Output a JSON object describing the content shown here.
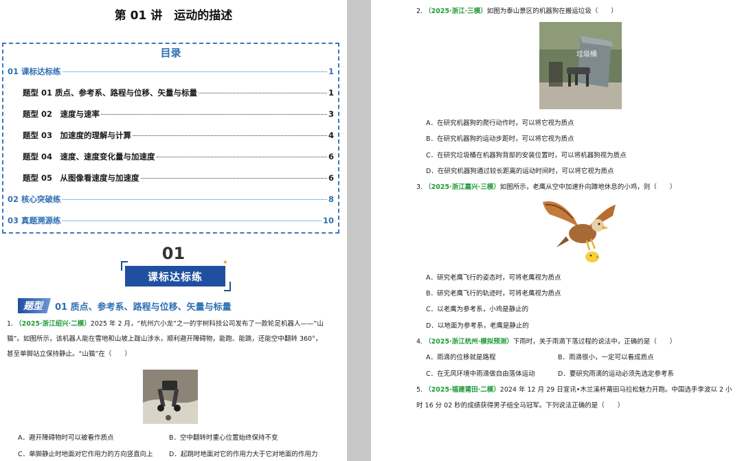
{
  "doc_title": "第 01 讲　运动的描述",
  "toc": {
    "heading": "目录",
    "lines": [
      {
        "label": "01  课标达标练",
        "page": "1",
        "level": 1
      },
      {
        "label": "题型 01  质点、参考系、路程与位移、矢量与标量",
        "page": "1",
        "level": 2
      },
      {
        "label": "题型 02　速度与速率",
        "page": "3",
        "level": 2
      },
      {
        "label": "题型 03　加速度的理解与计算",
        "page": "4",
        "level": 2
      },
      {
        "label": "题型 04　速度、速度变化量与加速度",
        "page": "6",
        "level": 2
      },
      {
        "label": "题型 05　从图像看速度与加速度",
        "page": "6",
        "level": 2
      },
      {
        "label": "02  核心突破练",
        "page": "8",
        "level": 1
      },
      {
        "label": "03  真题溯源练",
        "page": "10",
        "level": 1
      }
    ]
  },
  "section": {
    "number": "01",
    "banner": "课标达标练"
  },
  "topic": {
    "tag": "题型",
    "title": "01  质点、参考系、路程与位移、矢量与标量"
  },
  "questions": {
    "q1": {
      "num": "1.",
      "source": "（2025·浙江绍兴·二模）",
      "line1": "2025 年 2 月，“杭州六小龙”之一的宇树科技公司发布了一款轮足机器人——“山",
      "line2": "猫”。如图所示，该机器人能在雪地和山坡上跋山涉水，顺利避开障碍物，能跑、能跳，还能空中翻转 360°，",
      "line3": "甚至单脚站立保持静止。“山猫”在（　　）",
      "choices": {
        "A": "A．避开障碍物时可以被看作质点",
        "B": "B．空中翻转时重心位置始终保持不变",
        "C": "C．单脚静止时地面对它作用力的方向竖直向上",
        "D": "D．起跳时地面对它的作用力大于它对地面的作用力"
      }
    },
    "q2": {
      "num": "2.",
      "source": "（2025·浙江·三模）",
      "stem": "如图为泰山景区的机器狗在搬运垃圾（　　）",
      "photo_label": "垃圾桶",
      "choices": {
        "A": "A．在研究机器狗的爬行动作时，可以将它视为质点",
        "B": "B．在研究机器狗的运动步距时，可以将它视为质点",
        "C": "C．在研究垃圾桶在机器狗背部的安装位置时，可以将机器狗视为质点",
        "D": "D．在研究机器狗通过较长距离的运动时间时，可以将它视为质点"
      }
    },
    "q3": {
      "num": "3.",
      "source": "（2025·浙江嘉兴·三模）",
      "stem": "如图所示，老鹰从空中加速扑向蹲地休息的小鸡，则（　　）",
      "choices": {
        "A": "A．研究老鹰飞行的姿态时，可将老鹰视为质点",
        "B": "B．研究老鹰飞行的轨迹时，可将老鹰视为质点",
        "C": "C．以老鹰为参考系，小鸡是静止的",
        "D": "D．以地面为参考系，老鹰是静止的"
      }
    },
    "q4": {
      "num": "4.",
      "source": "（2025·浙江杭州·模拟预测）",
      "stem": "下雨时，关于雨滴下落过程的说法中，正确的是（　　）",
      "choices": {
        "A": "A．雨滴的位移就是路程",
        "B": "B．雨滴很小，一定可以看成质点",
        "C": "C．在无风环境中雨滴做自由落体运动",
        "D": "D．要研究雨滴的运动必须先选定参考系"
      }
    },
    "q5": {
      "num": "5.",
      "source": "（2025·福建莆田·二模）",
      "line1": "2024 年 12 月 29 日宣讯•木兰溪杯莆田马拉松魅力开跑。中国选手李波以 2 小",
      "line2": "时 16 分 02 秒的成绩获得男子组全马冠军。下列说法正确的是（　　）"
    }
  },
  "colors": {
    "accent_blue": "#2d6fb3",
    "banner_blue": "#1e4fa0",
    "source_green": "#1e9a3a"
  }
}
